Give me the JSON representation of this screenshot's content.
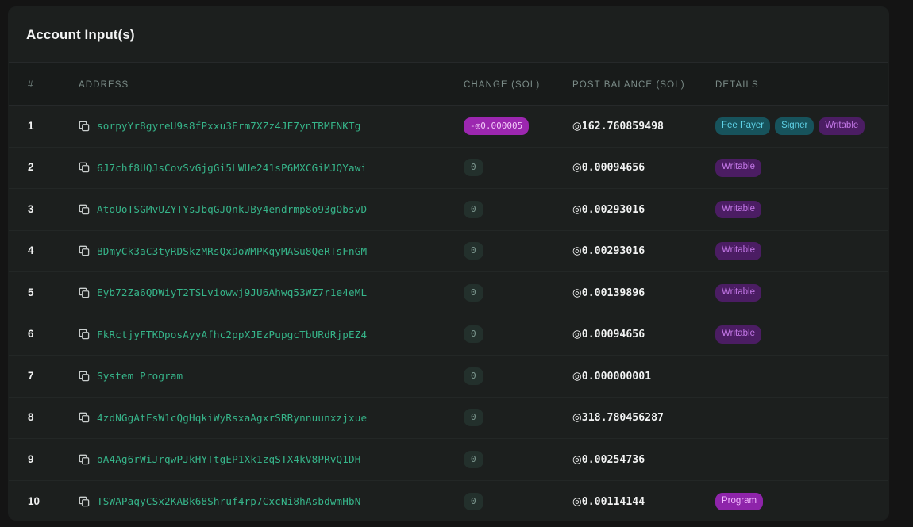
{
  "card": {
    "title": "Account Input(s)"
  },
  "table": {
    "columns": [
      {
        "key": "num",
        "label": "#"
      },
      {
        "key": "address",
        "label": "ADDRESS"
      },
      {
        "key": "change",
        "label": "CHANGE (SOL)"
      },
      {
        "key": "balance",
        "label": "POST BALANCE (SOL)"
      },
      {
        "key": "details",
        "label": "DETAILS"
      }
    ],
    "sol_symbol": "◎",
    "copy_icon": "copy-icon",
    "rows": [
      {
        "num": "1",
        "address": "sorpyYr8gyreU9s8fPxxu3Erm7XZz4JE7ynTRMFNKTg",
        "change": "-◎0.000005",
        "change_kind": "negative",
        "balance": "162.760859498",
        "details": [
          {
            "label": "Fee Payer",
            "style": "teal"
          },
          {
            "label": "Signer",
            "style": "teal"
          },
          {
            "label": "Writable",
            "style": "purple"
          }
        ]
      },
      {
        "num": "2",
        "address": "6J7chf8UQJsCovSvGjgGi5LWUe241sP6MXCGiMJQYawi",
        "change": "0",
        "change_kind": "zero",
        "balance": "0.00094656",
        "details": [
          {
            "label": "Writable",
            "style": "purple"
          }
        ]
      },
      {
        "num": "3",
        "address": "AtoUoTSGMvUZYTYsJbqGJQnkJBy4endrmp8o93gQbsvD",
        "change": "0",
        "change_kind": "zero",
        "balance": "0.00293016",
        "details": [
          {
            "label": "Writable",
            "style": "purple"
          }
        ]
      },
      {
        "num": "4",
        "address": "BDmyCk3aC3tyRDSkzMRsQxDoWMPKqyMASu8QeRTsFnGM",
        "change": "0",
        "change_kind": "zero",
        "balance": "0.00293016",
        "details": [
          {
            "label": "Writable",
            "style": "purple"
          }
        ]
      },
      {
        "num": "5",
        "address": "Eyb72Za6QDWiyT2TSLviowwj9JU6Ahwq53WZ7r1e4eML",
        "change": "0",
        "change_kind": "zero",
        "balance": "0.00139896",
        "details": [
          {
            "label": "Writable",
            "style": "purple"
          }
        ]
      },
      {
        "num": "6",
        "address": "FkRctjyFTKDposAyyAfhc2ppXJEzPupgcTbURdRjpEZ4",
        "change": "0",
        "change_kind": "zero",
        "balance": "0.00094656",
        "details": [
          {
            "label": "Writable",
            "style": "purple"
          }
        ]
      },
      {
        "num": "7",
        "address": "System Program",
        "change": "0",
        "change_kind": "zero",
        "balance": "0.000000001",
        "details": []
      },
      {
        "num": "8",
        "address": "4zdNGgAtFsW1cQgHqkiWyRsxaAgxrSRRynnuunxzjxue",
        "change": "0",
        "change_kind": "zero",
        "balance": "318.780456287",
        "details": []
      },
      {
        "num": "9",
        "address": "oA4Ag6rWiJrqwPJkHYTtgEP1Xk1zqSTX4kV8PRvQ1DH",
        "change": "0",
        "change_kind": "zero",
        "balance": "0.00254736",
        "details": []
      },
      {
        "num": "10",
        "address": "TSWAPaqyCSx2KABk68Shruf4rp7CxcNi8hAsbdwmHbN",
        "change": "0",
        "change_kind": "zero",
        "balance": "0.00114144",
        "details": [
          {
            "label": "Program",
            "style": "magenta"
          }
        ]
      }
    ]
  },
  "colors": {
    "page_background": "#141414",
    "card_background": "#1c1f1e",
    "header_background": "#181b1a",
    "address_text": "#36b58a",
    "column_header_text": "#7b8c88",
    "badge_negative": "#9c27b0",
    "badge_zero": "#23302c",
    "tag_teal": "#17535c",
    "tag_purple": "#4b1d63",
    "tag_magenta": "#8e24aa"
  }
}
